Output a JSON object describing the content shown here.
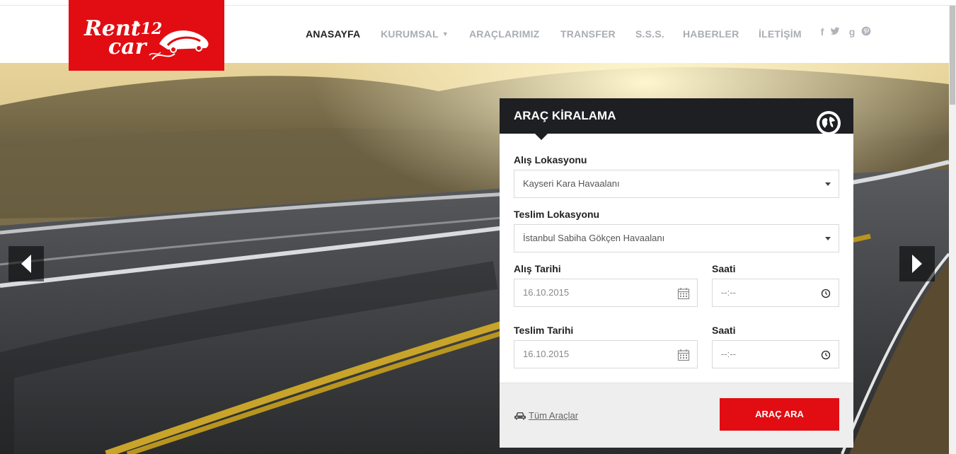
{
  "brand": {
    "logo_text": "Rent'12 car",
    "accent": "#e20d12"
  },
  "nav": {
    "items": [
      {
        "label": "ANASAYFA",
        "active": true
      },
      {
        "label": "KURUMSAL",
        "dropdown": true
      },
      {
        "label": "ARAÇLARIMIZ"
      },
      {
        "label": "TRANSFER"
      },
      {
        "label": "S.S.S."
      },
      {
        "label": "HABERLER"
      },
      {
        "label": "İLETİŞİM"
      }
    ],
    "social": [
      "facebook-icon",
      "twitter-icon",
      "google-plus-icon",
      "pinterest-icon"
    ],
    "social_glyphs": {
      "facebook": "f",
      "google": "g"
    }
  },
  "booking": {
    "title": "ARAÇ KİRALAMA",
    "pickup_location": {
      "label": "Alış Lokasyonu",
      "value": "Kayseri Kara Havaalanı"
    },
    "return_location": {
      "label": "Teslim Lokasyonu",
      "value": "İstanbul Sabiha Gökçen Havaalanı"
    },
    "pickup_date": {
      "label": "Alış Tarihi",
      "value": "16.10.2015"
    },
    "pickup_time": {
      "label": "Saati",
      "value": "--:--"
    },
    "return_date": {
      "label": "Teslim Tarihi",
      "value": "16.10.2015"
    },
    "return_time": {
      "label": "Saati",
      "value": "--:--"
    },
    "all_cars_link": "Tüm Araçlar",
    "search_button": "ARAÇ ARA"
  }
}
